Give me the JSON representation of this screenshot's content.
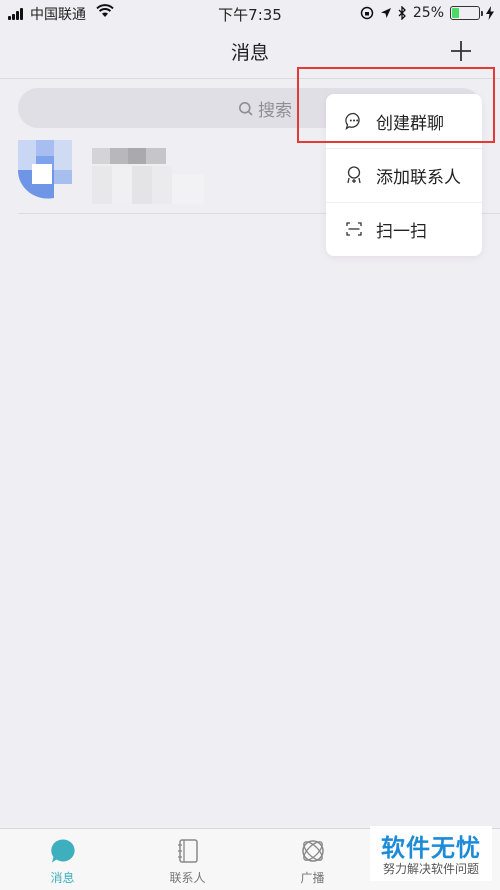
{
  "status_bar": {
    "carrier": "中国联通",
    "time": "下午7:35",
    "battery": "25%",
    "battery_level": 0.25
  },
  "header": {
    "title": "消息",
    "add_icon": "plus-icon"
  },
  "search": {
    "placeholder": "搜索",
    "icon": "search-icon"
  },
  "popup_menu": {
    "items": [
      {
        "label": "创建群聊",
        "icon": "chat-bubble-icon"
      },
      {
        "label": "添加联系人",
        "icon": "add-contact-icon"
      },
      {
        "label": "扫一扫",
        "icon": "scan-icon"
      }
    ]
  },
  "tab_bar": {
    "tabs": [
      {
        "label": "消息",
        "icon": "message-icon",
        "active": true
      },
      {
        "label": "联系人",
        "icon": "contacts-book-icon",
        "active": false
      },
      {
        "label": "广播",
        "icon": "broadcast-icon",
        "active": false
      },
      {
        "label": "",
        "icon": "profile-icon",
        "active": false
      }
    ]
  },
  "watermark": {
    "title": "软件无忧",
    "subtitle": "努力解决软件问题"
  },
  "colors": {
    "accent": "#3eb0bd",
    "background": "#efeef3",
    "highlight": "#e53935"
  }
}
